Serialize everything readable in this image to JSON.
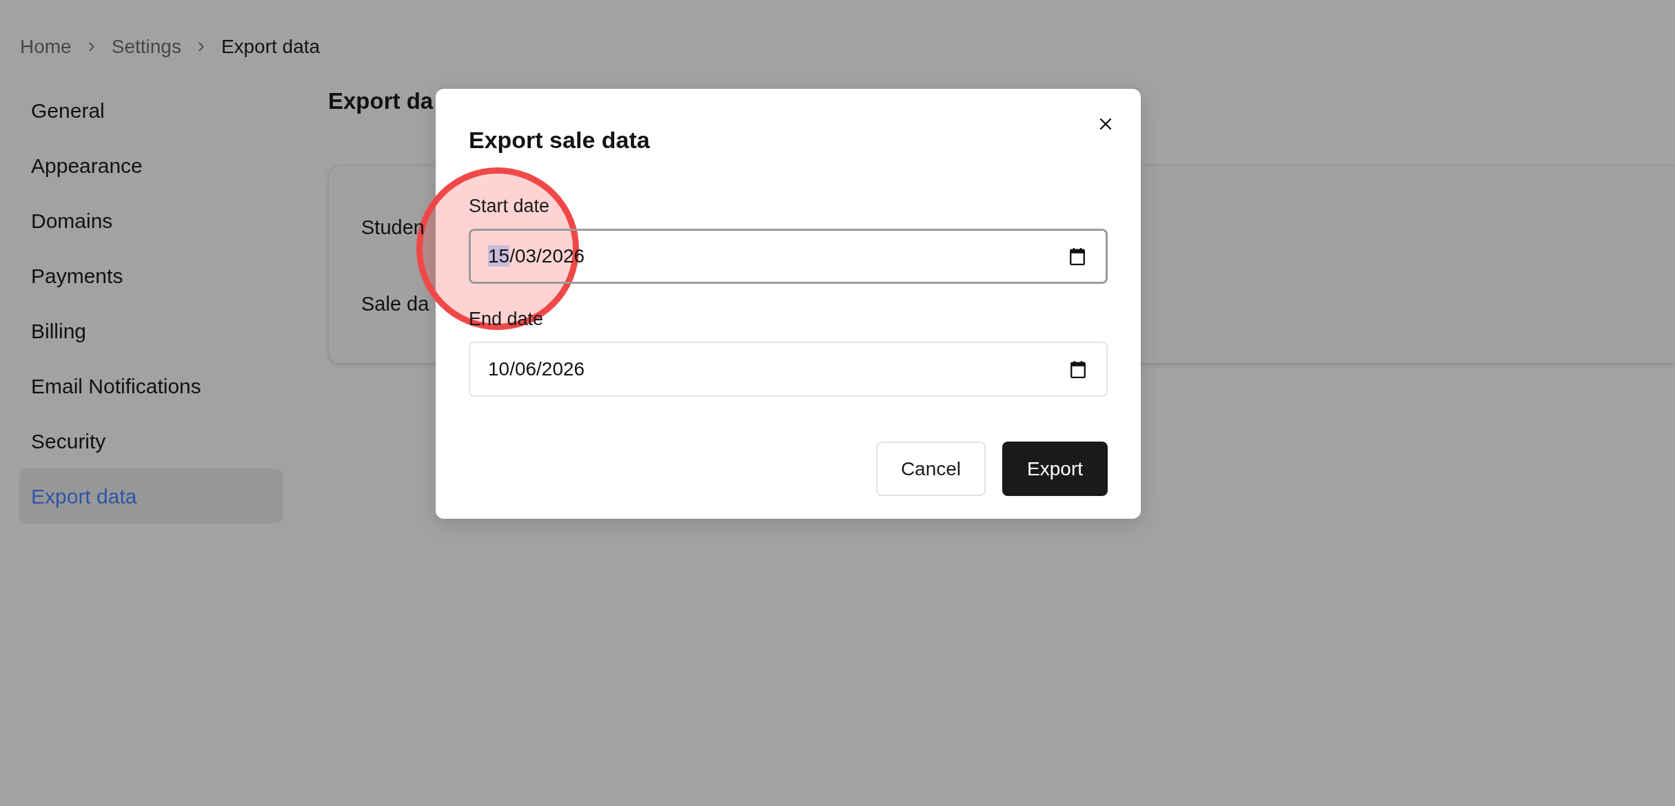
{
  "breadcrumb": {
    "items": [
      {
        "label": "Home",
        "current": false
      },
      {
        "label": "Settings",
        "current": false
      },
      {
        "label": "Export data",
        "current": true
      }
    ]
  },
  "sidebar": {
    "items": [
      {
        "label": "General",
        "selected": false
      },
      {
        "label": "Appearance",
        "selected": false
      },
      {
        "label": "Domains",
        "selected": false
      },
      {
        "label": "Payments",
        "selected": false
      },
      {
        "label": "Billing",
        "selected": false
      },
      {
        "label": "Email Notifications",
        "selected": false
      },
      {
        "label": "Security",
        "selected": false
      },
      {
        "label": "Export data",
        "selected": true
      }
    ]
  },
  "page": {
    "title": "Export da",
    "card": {
      "rows": [
        {
          "label": "Studen"
        },
        {
          "label": "Sale da"
        }
      ]
    }
  },
  "dialog": {
    "title": "Export sale data",
    "fields": [
      {
        "label": "Start date",
        "focused": true,
        "value": [
          {
            "text": "15",
            "selected": true
          },
          {
            "text": "/03/2026",
            "selected": false
          }
        ]
      },
      {
        "label": "End date",
        "focused": false,
        "value": [
          {
            "text": "10/06/2026",
            "selected": false
          }
        ]
      }
    ],
    "buttons": [
      {
        "label": "Cancel",
        "kind": "secondary"
      },
      {
        "label": "Export",
        "kind": "primary"
      }
    ]
  }
}
